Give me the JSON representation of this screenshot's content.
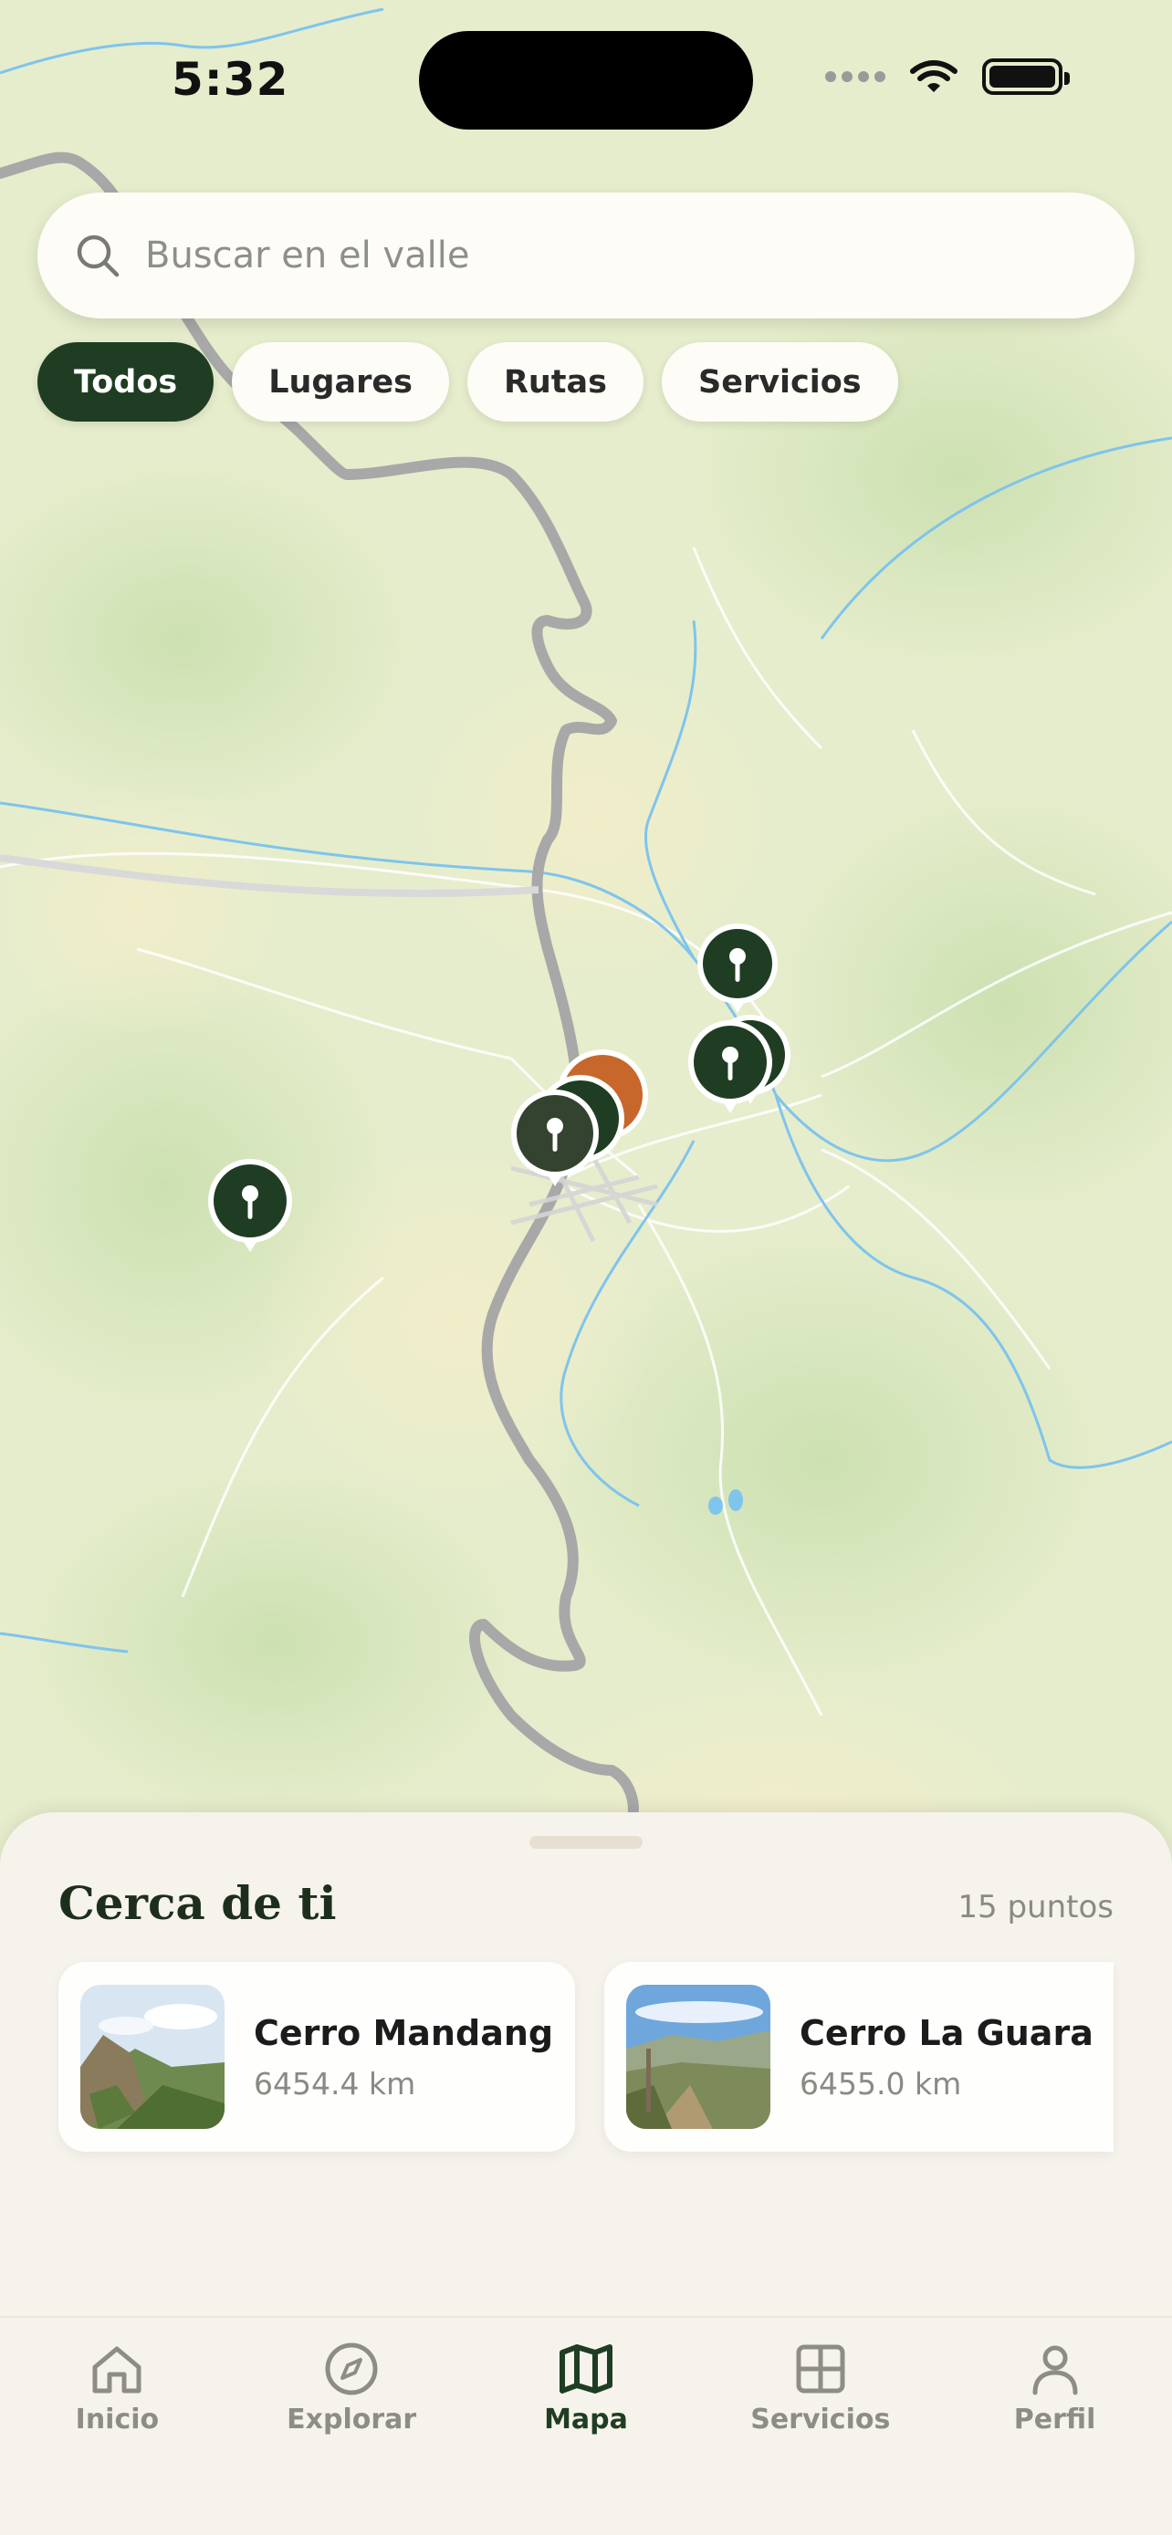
{
  "status": {
    "time": "5:32"
  },
  "search": {
    "placeholder": "Buscar en el valle"
  },
  "filters": [
    {
      "label": "Todos",
      "active": true
    },
    {
      "label": "Lugares",
      "active": false
    },
    {
      "label": "Rutas",
      "active": false
    },
    {
      "label": "Servicios",
      "active": false
    }
  ],
  "map": {
    "pins": [
      {
        "name": "map-pin",
        "color": "#1f3d22",
        "type": "pin"
      },
      {
        "name": "map-pin",
        "color": "#1f3d22",
        "type": "pin"
      },
      {
        "name": "map-pin",
        "color": "#1f3d22",
        "type": "pin"
      },
      {
        "name": "map-pin",
        "color": "#c8672b",
        "type": "cluster"
      },
      {
        "name": "map-pin",
        "color": "#1f3d22",
        "type": "cluster"
      },
      {
        "name": "map-pin",
        "color": "#34432f",
        "type": "pin"
      },
      {
        "name": "map-pin",
        "color": "#1f3d22",
        "type": "pin"
      }
    ]
  },
  "sheet": {
    "title": "Cerca de ti",
    "count": "15 puntos",
    "cards": [
      {
        "name": "Cerro Mandango",
        "distance": "6454.4 km"
      },
      {
        "name": "Cerro La Guaran...",
        "distance": "6455.0 km"
      }
    ]
  },
  "tabs": [
    {
      "label": "Inicio",
      "icon": "home-icon"
    },
    {
      "label": "Explorar",
      "icon": "compass-icon"
    },
    {
      "label": "Mapa",
      "icon": "map-icon",
      "active": true
    },
    {
      "label": "Servicios",
      "icon": "grid-icon"
    },
    {
      "label": "Perfil",
      "icon": "person-icon"
    }
  ],
  "colors": {
    "accent": "#1f3d22",
    "cluster_orange": "#c8672b",
    "map_base": "#e9efcf",
    "road": "#a9a9a9",
    "river": "#7fc4ec"
  }
}
